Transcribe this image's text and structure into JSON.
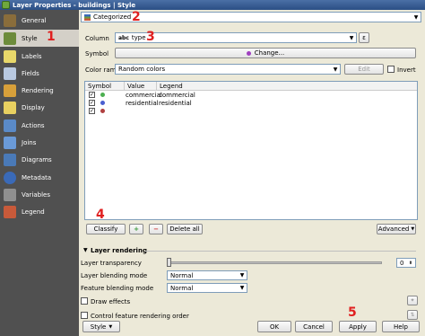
{
  "window": {
    "title": "Layer Properties - buildings | Style"
  },
  "sidebar": {
    "items": [
      {
        "label": "General",
        "icon": "tools-icon",
        "color": "#8a6d3b"
      },
      {
        "label": "Style",
        "icon": "paintbrush-icon",
        "color": "#6d8b3b"
      },
      {
        "label": "Labels",
        "icon": "labels-icon",
        "color": "#e8d86a"
      },
      {
        "label": "Fields",
        "icon": "fields-icon",
        "color": "#b9c9e0"
      },
      {
        "label": "Rendering",
        "icon": "rendering-icon",
        "color": "#d8a03a"
      },
      {
        "label": "Display",
        "icon": "display-icon",
        "color": "#e8d060"
      },
      {
        "label": "Actions",
        "icon": "actions-icon",
        "color": "#5a8ac8"
      },
      {
        "label": "Joins",
        "icon": "joins-icon",
        "color": "#6a9ad8"
      },
      {
        "label": "Diagrams",
        "icon": "diagrams-icon",
        "color": "#4a7ab8"
      },
      {
        "label": "Metadata",
        "icon": "info-icon",
        "color": "#3a6ab8"
      },
      {
        "label": "Variables",
        "icon": "variables-icon",
        "color": "#909090"
      },
      {
        "label": "Legend",
        "icon": "legend-icon",
        "color": "#c85a3a"
      }
    ]
  },
  "renderer": {
    "value": "Categorized"
  },
  "column": {
    "label": "Column",
    "type_badge": "abc",
    "value": "type"
  },
  "symbol": {
    "label": "Symbol",
    "button": "Change..."
  },
  "color_ramp": {
    "label": "Color ramp",
    "value": "Random colors",
    "edit": "Edit",
    "invert": "Invert"
  },
  "table": {
    "headers": [
      "Symbol",
      "Value",
      "Legend"
    ],
    "rows": [
      {
        "checked": "✓",
        "color": "#4caf50",
        "value": "commercial",
        "legend": "commercial"
      },
      {
        "checked": "✓",
        "color": "#4a5fd0",
        "value": "residential",
        "legend": "residential"
      },
      {
        "checked": "✓",
        "color": "#b04040",
        "value": "",
        "legend": ""
      }
    ]
  },
  "actions": {
    "classify": "Classify",
    "delete_all": "Delete all",
    "advanced": "Advanced"
  },
  "layer_rendering": {
    "title": "Layer rendering",
    "transparency_label": "Layer transparency",
    "transparency_value": "0",
    "blending_label": "Layer blending mode",
    "blending_value": "Normal",
    "feature_blending_label": "Feature blending mode",
    "feature_blending_value": "Normal",
    "draw_effects": "Draw effects",
    "control_order": "Control feature rendering order"
  },
  "footer": {
    "style": "Style",
    "ok": "OK",
    "cancel": "Cancel",
    "apply": "Apply",
    "help": "Help"
  },
  "annotations": [
    "1",
    "2",
    "3",
    "4",
    "5"
  ]
}
